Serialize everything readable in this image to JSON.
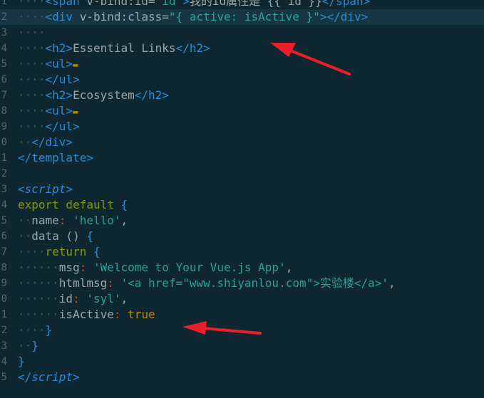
{
  "editor": {
    "lines": [
      {
        "n": "1",
        "segs": [
          [
            "ws",
            "····"
          ],
          [
            "t",
            "<span"
          ],
          [
            "a",
            " v-bind:id="
          ],
          [
            "s",
            "\"id\""
          ],
          [
            "t",
            ">"
          ],
          [
            "a",
            "我的id属性是 {{ id }}"
          ],
          [
            "t",
            "</span>"
          ]
        ]
      },
      {
        "n": "2",
        "cursor": true,
        "segs": [
          [
            "ws",
            "····"
          ],
          [
            "t",
            "<div"
          ],
          [
            "a",
            " v-bind:class="
          ],
          [
            "s",
            "\"{ active: isActive }\""
          ],
          [
            "t",
            "></div>"
          ]
        ]
      },
      {
        "n": "3",
        "segs": [
          [
            "ws",
            "····"
          ]
        ]
      },
      {
        "n": "4",
        "segs": [
          [
            "ws",
            "····"
          ],
          [
            "t",
            "<h2>"
          ],
          [
            "a",
            "Essential Links"
          ],
          [
            "t",
            "</h2>"
          ]
        ]
      },
      {
        "n": "5",
        "segs": [
          [
            "ws",
            "····"
          ],
          [
            "t",
            "<ul>"
          ],
          [
            "fold",
            "▬"
          ]
        ]
      },
      {
        "n": "6",
        "segs": [
          [
            "ws",
            "····"
          ],
          [
            "t",
            "</ul>"
          ]
        ]
      },
      {
        "n": "7",
        "segs": [
          [
            "ws",
            "····"
          ],
          [
            "t",
            "<h2>"
          ],
          [
            "a",
            "Ecosystem"
          ],
          [
            "t",
            "</h2>"
          ]
        ]
      },
      {
        "n": "8",
        "segs": [
          [
            "ws",
            "····"
          ],
          [
            "t",
            "<ul>"
          ],
          [
            "fold",
            "▬"
          ]
        ]
      },
      {
        "n": "9",
        "segs": [
          [
            "ws",
            "····"
          ],
          [
            "t",
            "</ul>"
          ]
        ]
      },
      {
        "n": "0",
        "segs": [
          [
            "ws",
            "··"
          ],
          [
            "t",
            "</div>"
          ]
        ]
      },
      {
        "n": "1",
        "segs": [
          [
            "t",
            "</template>"
          ]
        ]
      },
      {
        "n": "2",
        "segs": []
      },
      {
        "n": "3",
        "segs": [
          [
            "t",
            "<"
          ],
          [
            "tit",
            "script"
          ],
          [
            "t",
            ">"
          ]
        ]
      },
      {
        "n": "4",
        "segs": [
          [
            "k",
            "export default "
          ],
          [
            "t",
            "{"
          ]
        ]
      },
      {
        "n": "5",
        "segs": [
          [
            "ws",
            "··"
          ],
          [
            "pr",
            "name"
          ],
          [
            "c",
            ":"
          ],
          [
            "s",
            " 'hello'"
          ],
          [
            "p",
            ","
          ]
        ]
      },
      {
        "n": "6",
        "segs": [
          [
            "ws",
            "··"
          ],
          [
            "pr",
            "data ()"
          ],
          [
            "t",
            " {"
          ]
        ]
      },
      {
        "n": "7",
        "segs": [
          [
            "ws",
            "····"
          ],
          [
            "k",
            "return"
          ],
          [
            "t",
            " {"
          ]
        ]
      },
      {
        "n": "8",
        "segs": [
          [
            "ws",
            "······"
          ],
          [
            "pr",
            "msg"
          ],
          [
            "c",
            ":"
          ],
          [
            "s",
            " 'Welcome to Your Vue.js App'"
          ],
          [
            "p",
            ","
          ]
        ]
      },
      {
        "n": "9",
        "segs": [
          [
            "ws",
            "······"
          ],
          [
            "pr",
            "htmlmsg"
          ],
          [
            "c",
            ":"
          ],
          [
            "s",
            " '<a href=\"www.shiyanlou.com\">实验楼</a>'"
          ],
          [
            "p",
            ","
          ]
        ]
      },
      {
        "n": "0",
        "segs": [
          [
            "ws",
            "······"
          ],
          [
            "pr",
            "id"
          ],
          [
            "c",
            ":"
          ],
          [
            "s",
            " 'syl'"
          ],
          [
            "p",
            ","
          ]
        ]
      },
      {
        "n": "1",
        "segs": [
          [
            "ws",
            "······"
          ],
          [
            "pr",
            "isActive"
          ],
          [
            "c",
            ":"
          ],
          [
            "b",
            " true"
          ]
        ]
      },
      {
        "n": "2",
        "segs": [
          [
            "ws",
            "····"
          ],
          [
            "t",
            "}"
          ]
        ]
      },
      {
        "n": "3",
        "segs": [
          [
            "ws",
            "··"
          ],
          [
            "t",
            "}"
          ]
        ]
      },
      {
        "n": "4",
        "segs": [
          [
            "t",
            "}"
          ]
        ]
      },
      {
        "n": "5",
        "segs": [
          [
            "t",
            "</"
          ],
          [
            "tit",
            "script"
          ],
          [
            "t",
            ">"
          ]
        ]
      }
    ]
  },
  "annotations": {
    "arrow_color": "#e8202a"
  }
}
